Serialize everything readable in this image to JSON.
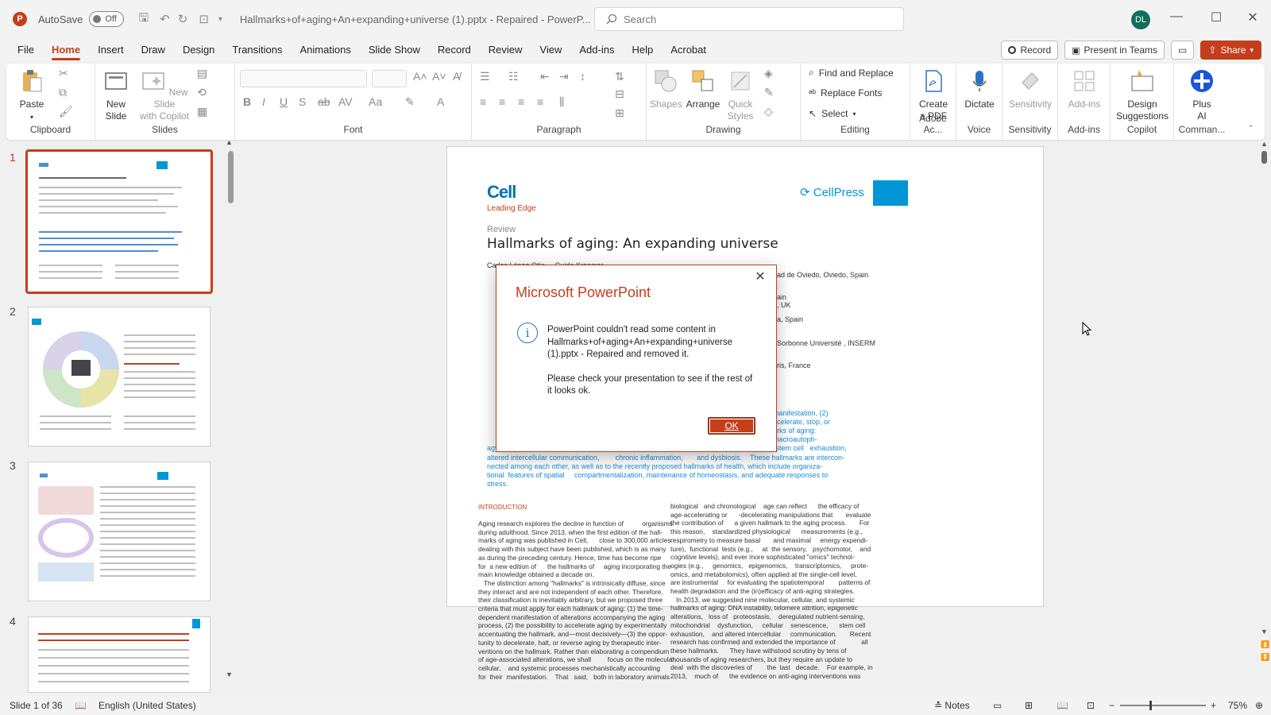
{
  "titlebar": {
    "autosave_label": "AutoSave",
    "autosave_state": "Off",
    "document_title": "Hallmarks+of+aging+An+expanding+universe (1).pptx  -  Repaired  -  PowerP...",
    "search_placeholder": "Search",
    "user_initials": "DL"
  },
  "menu": {
    "tabs": [
      "File",
      "Home",
      "Insert",
      "Draw",
      "Design",
      "Transitions",
      "Animations",
      "Slide Show",
      "Record",
      "Review",
      "View",
      "Add-ins",
      "Help",
      "Acrobat"
    ],
    "active": "Home",
    "record_label": "Record",
    "present_label": "Present in Teams",
    "share_label": "Share"
  },
  "ribbon": {
    "clipboard": {
      "label": "Clipboard",
      "paste": "Paste"
    },
    "slides": {
      "label": "Slides",
      "new_slide_1": "New",
      "new_slide_2": "Slide",
      "copilot_1": "New Slide",
      "copilot_2": "with Copilot"
    },
    "font": {
      "label": "Font"
    },
    "paragraph": {
      "label": "Paragraph"
    },
    "drawing": {
      "label": "Drawing",
      "shapes": "Shapes",
      "arrange": "Arrange",
      "quick_1": "Quick",
      "quick_2": "Styles"
    },
    "editing": {
      "label": "Editing",
      "find": "Find and Replace",
      "replace_fonts": "Replace Fonts",
      "select": "Select"
    },
    "adobe": {
      "label": "Adobe Ac...",
      "create_1": "Create",
      "create_2": "a PDF"
    },
    "voice": {
      "label": "Voice",
      "dictate": "Dictate"
    },
    "sensitivity": {
      "label": "Sensitivity",
      "btn": "Sensitivity"
    },
    "addins": {
      "label": "Add-ins",
      "btn": "Add-ins"
    },
    "copilot": {
      "label": "Copilot",
      "design_1": "Design",
      "design_2": "Suggestions"
    },
    "commands": {
      "label": "Comman...",
      "plus_1": "Plus",
      "plus_2": "AI"
    }
  },
  "thumbnails": [
    {
      "number": "1",
      "selected": true
    },
    {
      "number": "2",
      "selected": false
    },
    {
      "number": "3",
      "selected": false
    },
    {
      "number": "4",
      "selected": false
    }
  ],
  "slide": {
    "journal": "Cell",
    "leading_edge": "Leading Edge",
    "review": "Review",
    "title": "Hallmarks of aging: An expanding universe",
    "publisher": "CellPress",
    "author_line": "Carlos López-Otín ... Guido Kroemer",
    "affil_1": "dad de Oviedo, Oviedo, Spain",
    "affil_2": "pain",
    "affil_3": "n, UK",
    "affil_4": "na, Spain",
    "affil_5": ", Sorbonne Université , INSERM",
    "affil_6": "aris, France",
    "summary_1": "manifestation, (2)",
    "summary_2": "ecelerate, stop, or",
    "summary_3": "arks of aging:",
    "summary_4": "macroautoph-",
    "summary_5": "agy,   deregulated nutrient-sensing,     mitochondrial dysfunction,     cellular senescence,     stem cell   exhaustion,",
    "summary_6": "altered intercellular communication,        chronic inflammation,       and dysbiosis.    These hallmarks are intercon-",
    "summary_7": "nected among each other, as well as to the recently proposed hallmarks of health, which include organiza-",
    "summary_8": "tional  features of spatial     compartmentalization, maintenance of homeostasis, and adequate responses to",
    "summary_9": "stress.",
    "intro_heading": "INTRODUCTION",
    "col1": [
      "Aging research explores the decline in function of          organisms",
      "during adulthood. Since 2013, when the first edition of the hall-",
      "marks of aging was published in Cell,      close to 300,000 articles",
      "dealing with this subject have been published, which is as many",
      "as during the preceding century. Hence, time has become ripe",
      "for  a new edition of      the hallmarks of     aging incorporating the",
      "main knowledge obtained a decade on.",
      "   The distinction among \"hallmarks\" is intrinsically diffuse, since",
      "they interact and are not independent of each other. Therefore,",
      "their classification is inevitably arbitrary, but we proposed three",
      "criteria that must apply for each hallmark of aging: (1) the time-",
      "dependent manifestation of alterations accompanying the aging",
      "process, (2) the possibility to accelerate aging by experimentally",
      "accentuating the hallmark, and—most decisively—(3) the oppor-",
      "tunity to decelerate, halt, or reverse aging by therapeutic inter-",
      "ventions on the hallmark. Rather than elaborating a compendium",
      "of age-associated alterations, we shall         focus on the molecular,",
      "cellular,    and systemic processes mechanistically accounting",
      "for  their  manifestation.    That   said,   both in laboratory animals"
    ],
    "col2": [
      "biological   and chronological    age can reflect      the efficacy of",
      "age-accelerating or      -decelerating manipulations that       evaluate",
      "the contribution of      a given hallmark to the aging process.       For",
      "this reason,    standardized physiological      measurements (e.g.,",
      "respirometry to measure basal       and maximal     energy expendi-",
      "ture),  functional  tests (e.g.,     at  the sensory,   psychomotor,    and",
      "cognitive levels), and ever more sophisticated \"omics\" technol-",
      "ogies (e.g.,     genomics,   epigenomics,    transcriptomics,     prote-",
      "omics, and metabolomics), often applied at the single-cell level,",
      "are instrumental     for evaluating the spatiotemporal        patterns of",
      "health degradation and the (in)efficacy of anti-aging strategies.",
      "   In 2013, we suggested nine molecular, cellular, and systemic",
      "hallmarks of aging: DNA instability, telomere attrition, epigenetic",
      "alterations,   loss of   proteostasis,    deregulated nutrient-sensing,",
      "mitochondrial    dysfunction,     cellular    senescence,      stem cell",
      "exhaustion,    and altered intercellular     communication.       Recent",
      "research has confirmed and extended the importance of              all",
      "these hallmarks.      They have withstood scrutiny by tens of",
      "thousands of aging researchers, but they require an update to",
      "deal  with the discoveries of        the  last   decade.    For example, in",
      "2013,    much of      the evidence on anti-aging interventions was"
    ]
  },
  "dialog": {
    "title": "Microsoft PowerPoint",
    "message_1": "PowerPoint couldn't read some content in Hallmarks+of+aging+An+expanding+universe (1).pptx  -  Repaired and removed it.",
    "message_2": "Please check your presentation to see if the rest of it looks ok.",
    "ok_label": "OK"
  },
  "status": {
    "slide_counter": "Slide 1 of 36",
    "language": "English (United States)",
    "notes": "Notes",
    "zoom": "75%"
  },
  "colors": {
    "accent": "#c43e1c",
    "cell_blue": "#0070c0",
    "cellpress_blue": "#0096d6",
    "summary_blue": "#1b8ad0"
  }
}
